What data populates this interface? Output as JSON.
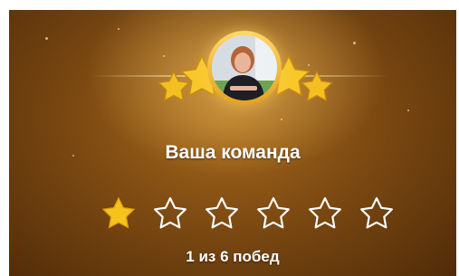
{
  "team": {
    "title": "Ваша команда",
    "avatar_icon": "team-photo-avatar"
  },
  "rating": {
    "earned": 1,
    "total": 6,
    "caption": "1 из 6 побед"
  },
  "colors": {
    "gold": "#f6c21c",
    "star_outline": "#ffffff",
    "background_dark": "#4e2a08",
    "background_light": "#a86a1c"
  }
}
